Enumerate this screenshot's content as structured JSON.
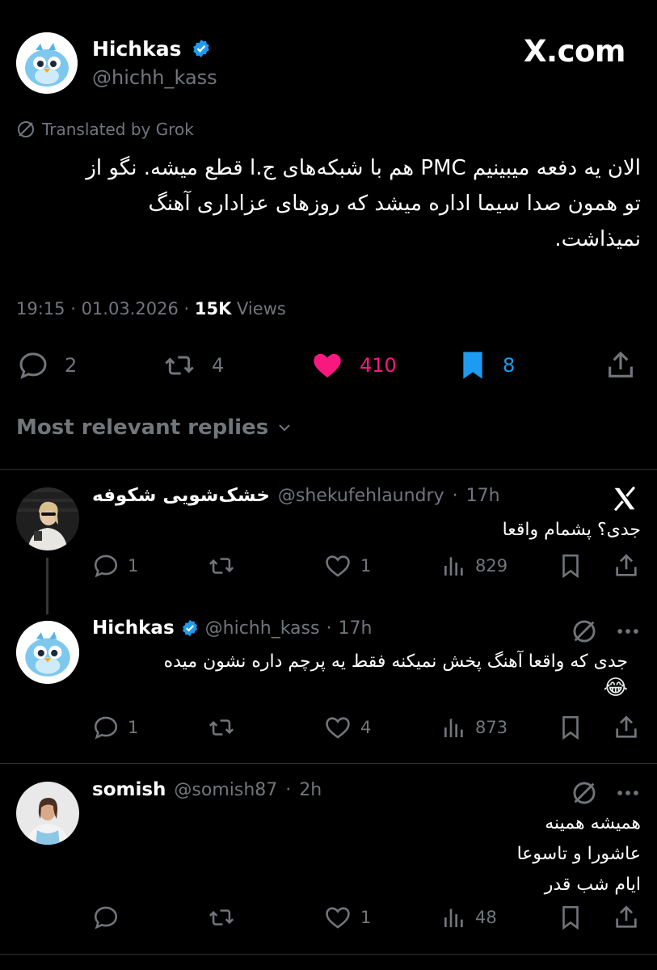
{
  "main_tweet": {
    "display_name": "Hichkas",
    "handle": "@hichh_kass",
    "site_watermark": "X.com",
    "translated_label": "Translated by Grok",
    "text": "الان یه دفعه میبینیم PMC هم با شبکه‌های ج.ا قطع میشه. نگو از تو همون صدا سیما اداره میشد که روزهای عزاداری آهنگ نمیذاشت.",
    "time": "19:15",
    "date": "01.03.2026",
    "views_count": "15K",
    "views_label": "Views",
    "stats": {
      "replies": "2",
      "reposts": "4",
      "likes": "410",
      "bookmarks": "8"
    }
  },
  "replies_section": {
    "title": "Most relevant replies"
  },
  "replies": [
    {
      "display_name": "خشک‌شویی شکوفه",
      "handle": "@shekufehlaundry",
      "time": "17h",
      "text": "جدی؟ پشمام واقعا",
      "stats": {
        "replies": "1",
        "reposts": "",
        "likes": "1",
        "views": "829"
      }
    },
    {
      "display_name": "Hichkas",
      "handle": "@hichh_kass",
      "time": "17h",
      "text": "جدی که واقعا آهنگ پخش نمیکنه فقط یه پرچم داره نشون میده",
      "emoji": "😂",
      "stats": {
        "replies": "1",
        "reposts": "",
        "likes": "4",
        "views": "873"
      }
    },
    {
      "display_name": "somish",
      "handle": "@somish87",
      "time": "2h",
      "lines": [
        "همیشه همینه",
        "عاشورا و تاسوعا",
        "ایام شب قدر"
      ],
      "stats": {
        "replies": "",
        "reposts": "",
        "likes": "1",
        "views": "48"
      }
    }
  ],
  "colors": {
    "background": "#000000",
    "text": "#e7e9ea",
    "secondary": "#71767b",
    "like": "#f91880",
    "bookmark": "#1d9bf0",
    "verified": "#1d9bf0"
  }
}
